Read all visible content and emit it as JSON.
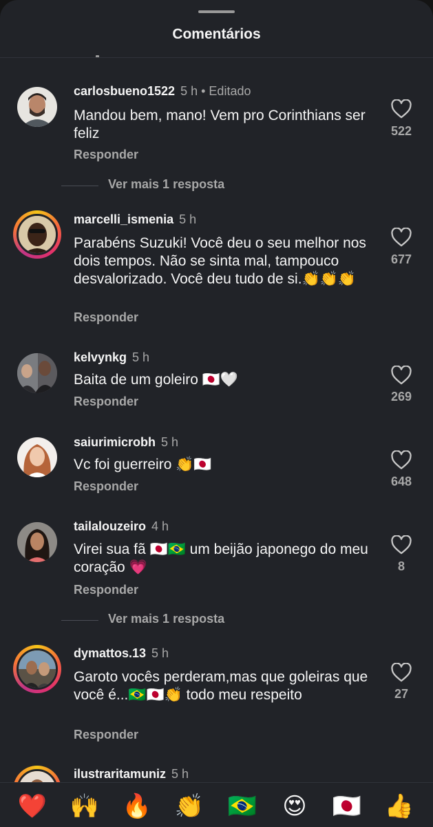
{
  "sheet": {
    "title": "Comentários"
  },
  "more_replies_label": "Ver mais 1 resposta",
  "reply_label": "Responder",
  "comments": [
    {
      "username": "carlosbueno1522",
      "time": "5 h",
      "edited": "• Editado",
      "text": "Mandou bem, mano! Vem pro Corinthians ser feliz",
      "likes": "522",
      "ring": false
    },
    {
      "username": "marcelli_ismenia",
      "time": "5 h",
      "text": "Parabéns Suzuki! Você deu o seu melhor nos dois tempos. Não se sinta mal, tampouco desvalorizado. Você deu tudo de si.👏👏👏",
      "likes": "677",
      "ring": true
    },
    {
      "username": "kelvynkg",
      "time": "5 h",
      "text": "Baita de um goleiro 🇯🇵🤍",
      "likes": "269",
      "ring": false
    },
    {
      "username": "saiurimicrobh",
      "time": "5 h",
      "text": "Vc foi guerreiro 👏🇯🇵",
      "likes": "648",
      "ring": false
    },
    {
      "username": "tailalouzeiro",
      "time": "4 h",
      "text": "Virei sua fã 🇯🇵🇧🇷 um beijão japonego do meu coração 💗",
      "likes": "8",
      "ring": false
    },
    {
      "username": "dymattos.13",
      "time": "5 h",
      "text": "Garoto vocês perderam,mas que goleiras que você é...🇧🇷🇯🇵👏 todo meu respeito",
      "likes": "27",
      "ring": true
    },
    {
      "username": "ilustraritamuniz",
      "time": "5 h",
      "ring": true
    }
  ],
  "emoji_bar": [
    {
      "icon": "red-heart-icon",
      "char": "❤️"
    },
    {
      "icon": "raising-hands-icon",
      "char": "🙌"
    },
    {
      "icon": "fire-icon",
      "char": "🔥"
    },
    {
      "icon": "clapping-hands-icon",
      "char": "👏"
    },
    {
      "icon": "brazil-flag-icon",
      "char": "🇧🇷"
    },
    {
      "icon": "heart-eyes-icon",
      "char": "😍"
    },
    {
      "icon": "japan-flag-icon",
      "char": "🇯🇵"
    },
    {
      "icon": "thumbs-up-icon",
      "char": "👍"
    }
  ],
  "colors": {
    "background": "#212328",
    "text": "#f5f5f5",
    "muted": "#a8a8a8",
    "divider": "#30333a"
  }
}
